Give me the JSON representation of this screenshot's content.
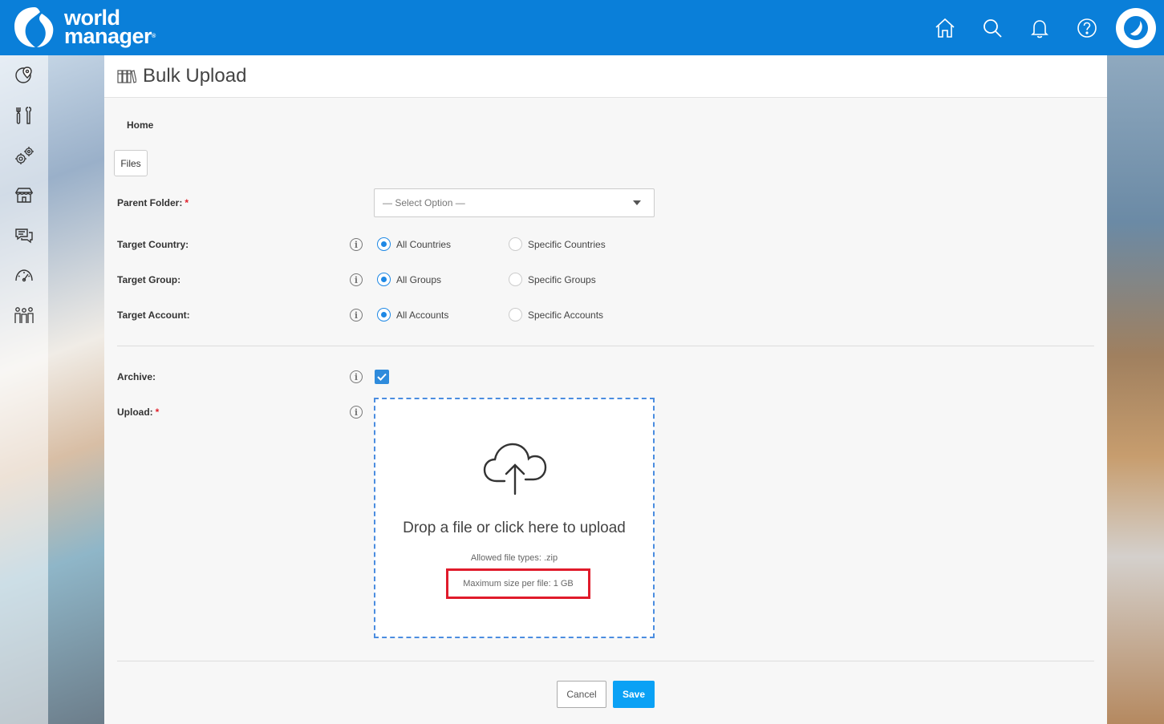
{
  "brand": {
    "line1": "world",
    "line2": "manager",
    "mark": "®",
    "color": "#0a7fd9"
  },
  "topnav": {
    "icons": [
      "home-icon",
      "search-icon",
      "bell-icon",
      "help-icon"
    ],
    "avatar_icon": "brand-swoosh-icon"
  },
  "sidebar": {
    "items": [
      "map-pin-icon",
      "tools-icon",
      "gears-icon",
      "store-icon",
      "chat-icon",
      "speedometer-icon",
      "people-icon"
    ]
  },
  "page": {
    "title": "Bulk Upload",
    "title_icon": "binders-icon",
    "breadcrumb": "Home",
    "files_button": "Files"
  },
  "form": {
    "parent_folder": {
      "label": "Parent Folder:",
      "required": "*",
      "placeholder": "— Select Option —"
    },
    "target_country": {
      "label": "Target Country:",
      "options": [
        "All Countries",
        "Specific Countries"
      ],
      "selected": "All Countries"
    },
    "target_group": {
      "label": "Target Group:",
      "options": [
        "All Groups",
        "Specific Groups"
      ],
      "selected": "All Groups"
    },
    "target_account": {
      "label": "Target Account:",
      "options": [
        "All Accounts",
        "Specific Accounts"
      ],
      "selected": "All Accounts"
    },
    "archive": {
      "label": "Archive:",
      "checked": true
    },
    "upload": {
      "label": "Upload:",
      "required": "*",
      "drop_text": "Drop a file or click here to upload",
      "allowed_types": "Allowed file types: .zip",
      "max_size": "Maximum size per file: 1 GB",
      "highlight_color": "#e01b2b"
    }
  },
  "actions": {
    "cancel": "Cancel",
    "save": "Save",
    "save_color": "#0aa1f5"
  }
}
